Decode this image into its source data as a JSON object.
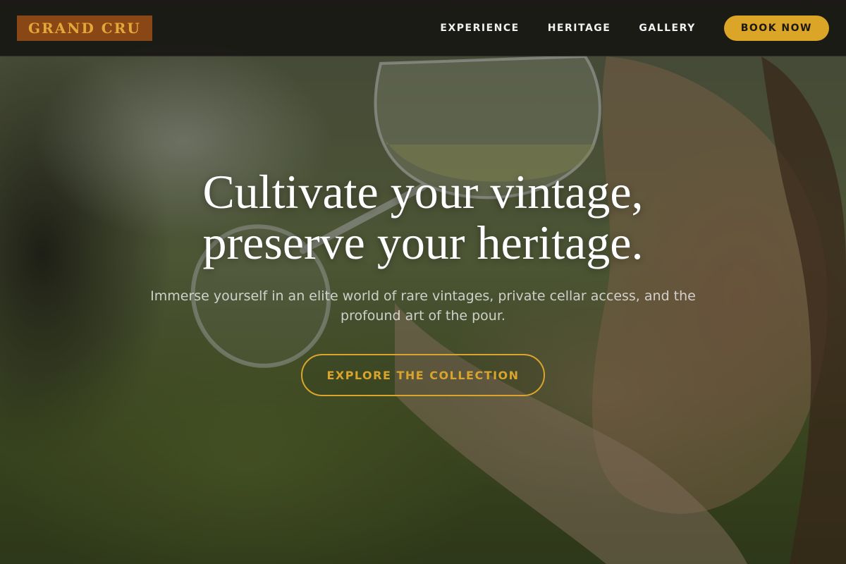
{
  "brand": {
    "logo_text": "GRAND CRU"
  },
  "nav": {
    "links": [
      {
        "label": "EXPERIENCE"
      },
      {
        "label": "HERITAGE"
      },
      {
        "label": "GALLERY"
      }
    ],
    "cta_label": "BOOK NOW"
  },
  "hero": {
    "title_line1": "Cultivate your vintage,",
    "title_line2": "preserve your heritage.",
    "subtitle": "Immerse yourself in an elite world of rare vintages, private cellar access, and the profound art of the pour.",
    "cta_label": "EXPLORE THE COLLECTION",
    "background_image": "woman-drinking-white-wine-photo"
  },
  "colors": {
    "accent_gold": "#dba527",
    "logo_bg": "#8a4716",
    "logo_text": "#e3a73a",
    "navbar_bg": "#161412"
  },
  "icons": []
}
